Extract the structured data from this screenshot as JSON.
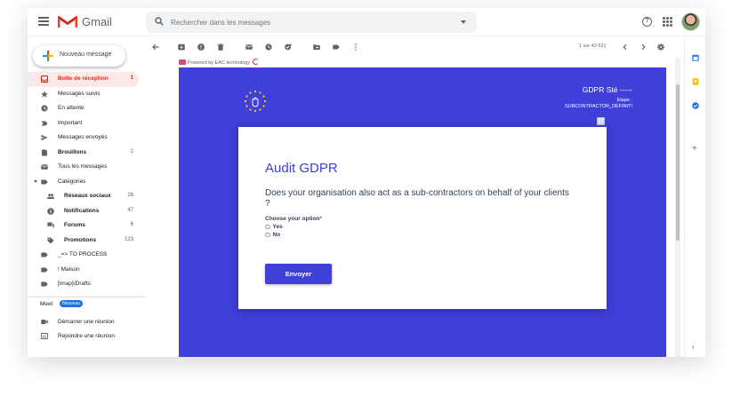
{
  "app": {
    "name": "Gmail",
    "accent_red": "#d93025",
    "email_brand_color": "#3f3fd9",
    "text_color": "#333f58"
  },
  "topbar": {
    "search_placeholder": "Rechercher dans les messages",
    "help_icon": "help-circle-icon",
    "apps_icon": "apps-grid-icon"
  },
  "sidebar": {
    "compose_label": "Nouveau message",
    "items": [
      {
        "label": "Boîte de réception",
        "count": "1",
        "icon": "inbox-icon"
      },
      {
        "label": "Messages suivis",
        "count": "",
        "icon": "star-icon"
      },
      {
        "label": "En attente",
        "count": "",
        "icon": "clock-icon"
      },
      {
        "label": "Important",
        "count": "",
        "icon": "important-icon"
      },
      {
        "label": "Messages envoyés",
        "count": "",
        "icon": "send-icon"
      },
      {
        "label": "Brouillons",
        "count": "2",
        "icon": "draft-icon"
      },
      {
        "label": "Tous les messages",
        "count": "",
        "icon": "mail-icon"
      },
      {
        "label": "Catégories",
        "count": "",
        "icon": "label-icon"
      },
      {
        "label": "Réseaux sociaux",
        "count": "28",
        "icon": "people-icon"
      },
      {
        "label": "Notifications",
        "count": "47",
        "icon": "info-icon"
      },
      {
        "label": "Forums",
        "count": "6",
        "icon": "forum-icon"
      },
      {
        "label": "Promotions",
        "count": "123",
        "icon": "tag-icon"
      },
      {
        "label": "_=> TO PROCESS",
        "count": "",
        "icon": "label-icon"
      },
      {
        "label": "! Maison",
        "count": "",
        "icon": "label-icon"
      },
      {
        "label": "[imap]/Drafts",
        "count": "",
        "icon": "label-icon"
      }
    ],
    "meet_title": "Meet",
    "meet_badge": "Nouveau",
    "meet_items": [
      {
        "label": "Démarrer une réunion",
        "icon": "video-icon"
      },
      {
        "label": "Rejoindre une réunion",
        "icon": "keyboard-icon"
      }
    ]
  },
  "toolbar": {
    "pager": "1 sur 43 521",
    "icons": [
      "back-arrow-icon",
      "archive-icon",
      "report-spam-icon",
      "delete-icon",
      "mark-unread-icon",
      "snooze-icon",
      "add-task-icon",
      "move-to-icon",
      "label-icon",
      "more-icon",
      "prev-icon",
      "next-icon",
      "settings-icon"
    ]
  },
  "email": {
    "powered_by": "Powered by EAC technology",
    "company": "GDPR Sté -----",
    "step_label": "Etape :",
    "step_name": "SUBCONTRACTOR_DEFINITI",
    "audit_title": "Audit GDPR",
    "question": "Does your organisation also act as a sub-contractors on behalf of your clients ?",
    "choose_label": "Choose your option",
    "required_mark": "*",
    "options": [
      "Yes",
      "No"
    ],
    "submit_label": "Envoyer"
  }
}
